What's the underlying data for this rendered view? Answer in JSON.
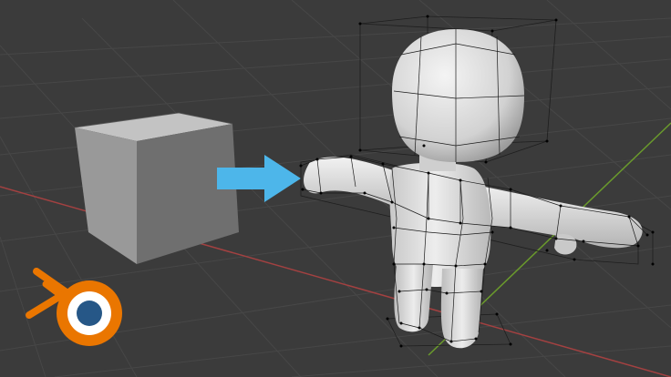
{
  "viewport": {
    "background": "#3b3b3b",
    "grid_color": "#4a4a4a",
    "x_axis_color": "#b14545",
    "y_axis_color": "#6fa32e"
  },
  "objects": {
    "cube": {
      "name": "Cube",
      "colors": {
        "front": "#6e6e6e",
        "top": "#bdbdbd",
        "side": "#8f8f8f"
      }
    },
    "arrow": {
      "color": "#4cb6ea"
    },
    "character": {
      "name": "Character",
      "mode": "edit",
      "body_color": "#d6d6d6",
      "wire_color": "#1a1a1a",
      "vertex_color": "#000000"
    },
    "bounding_box": {
      "color": "#1f1f1f"
    }
  },
  "logo": {
    "icon": "blender-logo-icon",
    "colors": {
      "orange": "#ea7600",
      "blue": "#265787",
      "white": "#ffffff"
    }
  }
}
